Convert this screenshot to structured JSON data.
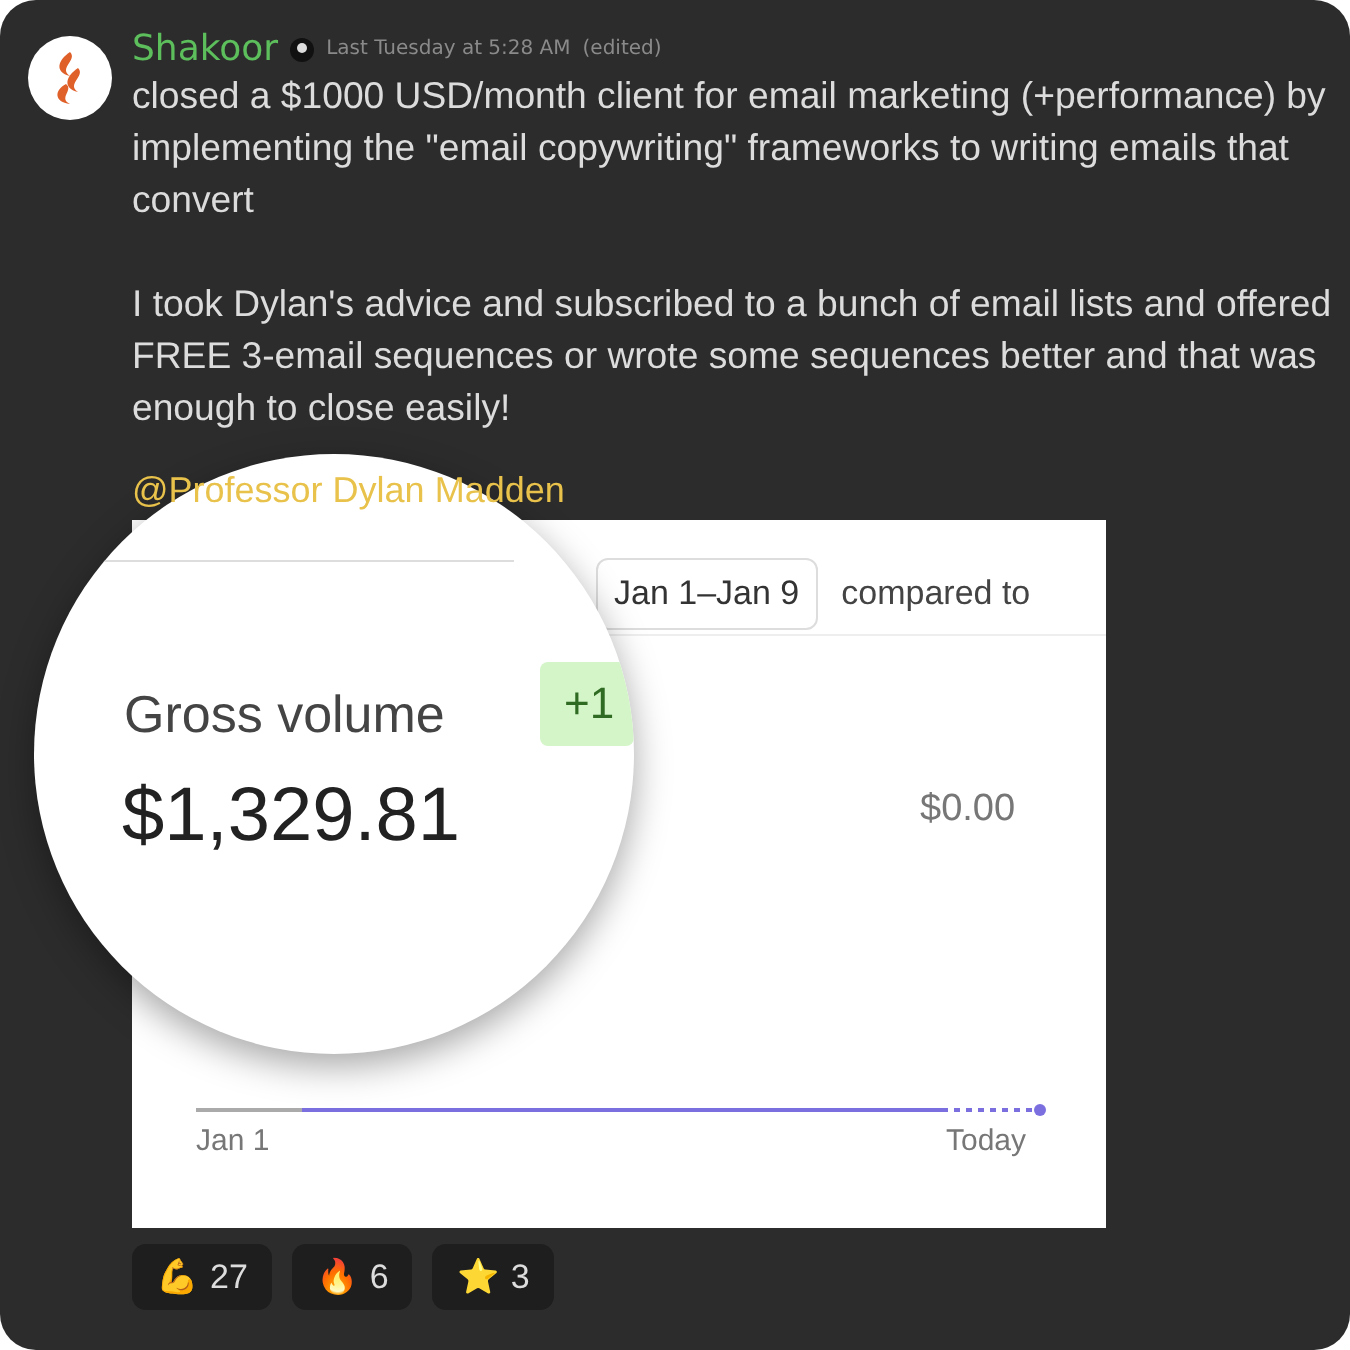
{
  "message": {
    "author": "Shakoor",
    "timestamp": "Last Tuesday at 5:28 AM",
    "edited": "(edited)",
    "paragraphs": [
      "closed a $1000 USD/month client for email marketing (+performance) by implementing the \"email copywriting\" frameworks to writing emails that convert",
      "I took Dylan's advice and subscribed to a bunch of email lists and offered FREE 3-email sequences or wrote some sequences better and that was enough to close easily!"
    ],
    "mention": "@Professor Dylan Madden"
  },
  "screenshot": {
    "date_range": "Jan 1–Jan 9",
    "compare_label": "compared to",
    "metric": "Gross volume",
    "change": "+1",
    "amount": "$1,329.81",
    "comparison_amount": "$0.00",
    "x_start": "Jan 1",
    "x_end": "Today"
  },
  "reactions": [
    {
      "emoji": "💪",
      "count": "27"
    },
    {
      "emoji": "🔥",
      "count": "6"
    },
    {
      "emoji": "⭐",
      "count": "3"
    }
  ]
}
